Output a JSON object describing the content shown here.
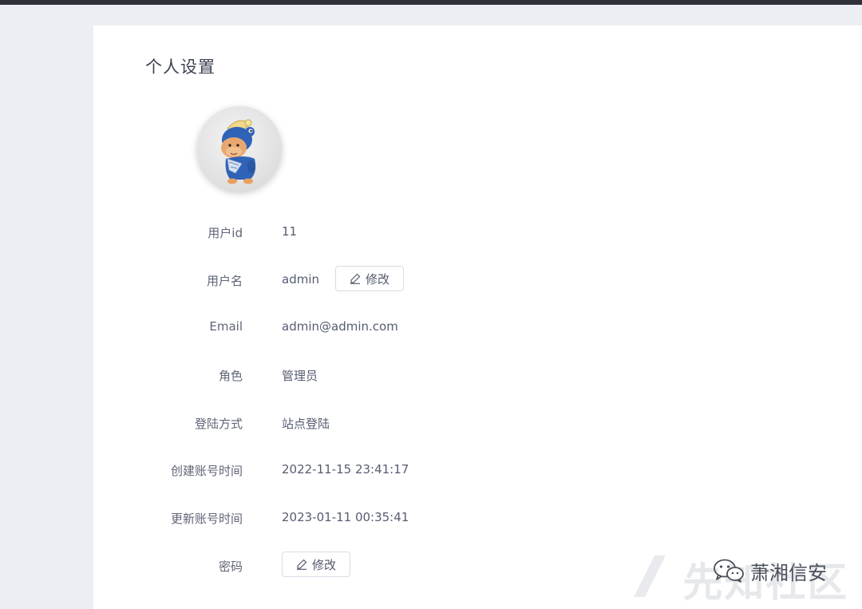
{
  "page": {
    "title": "个人设置"
  },
  "avatar": {
    "icon": "camel-mascot"
  },
  "fields": {
    "user_id": {
      "label": "用户id",
      "value": "11"
    },
    "username": {
      "label": "用户名",
      "value": "admin",
      "button": "修改"
    },
    "email": {
      "label": "Email",
      "value": "admin@admin.com"
    },
    "role": {
      "label": "角色",
      "value": "管理员"
    },
    "login_method": {
      "label": "登陆方式",
      "value": "站点登陆"
    },
    "created_at": {
      "label": "创建账号时间",
      "value": "2022-11-15 23:41:17"
    },
    "updated_at": {
      "label": "更新账号时间",
      "value": "2023-01-11 00:35:41"
    },
    "password": {
      "label": "密码",
      "button": "修改"
    }
  },
  "watermarks": {
    "site": "先知社区",
    "wechat": "萧湘信安"
  },
  "colors": {
    "topbar": "#2f3238",
    "background": "#eceef3",
    "card": "#ffffff"
  }
}
